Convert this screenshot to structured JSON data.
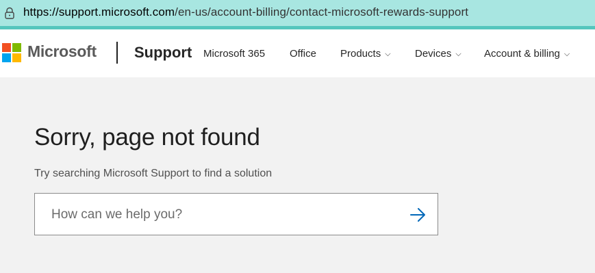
{
  "browser": {
    "url_host": "https://support.microsoft.com",
    "url_path": "/en-us/account-billing/contact-microsoft-rewards-support"
  },
  "header": {
    "brand": "Microsoft",
    "section": "Support",
    "nav": [
      {
        "label": "Microsoft 365",
        "dropdown": false
      },
      {
        "label": "Office",
        "dropdown": false
      },
      {
        "label": "Products",
        "dropdown": true
      },
      {
        "label": "Devices",
        "dropdown": true
      },
      {
        "label": "Account & billing",
        "dropdown": true
      }
    ],
    "chevron": "⌵"
  },
  "main": {
    "title": "Sorry, page not found",
    "subtitle": "Try searching Microsoft Support to find a solution",
    "search_placeholder": "How can we help you?"
  },
  "colors": {
    "logo_red": "#f25022",
    "logo_green": "#7fba00",
    "logo_blue": "#00a4ef",
    "logo_yellow": "#ffb900",
    "accent": "#0067b8"
  }
}
